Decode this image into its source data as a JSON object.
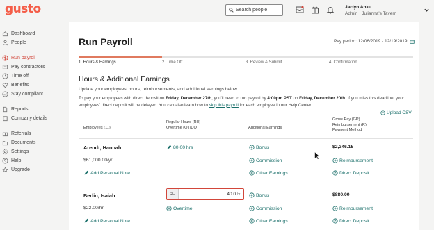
{
  "topbar": {
    "logo": "gusto",
    "search_placeholder": "Search people",
    "user_name": "Jaclyn Anku",
    "user_role": "Admin · Julianna's Tavern",
    "icons": [
      "inbox-icon",
      "gift-icon",
      "bell-icon",
      "chevron-down-icon"
    ]
  },
  "sidebar": {
    "groups": [
      [
        {
          "label": "Dashboard",
          "icon": "home-icon"
        },
        {
          "label": "People",
          "icon": "person-icon"
        }
      ],
      [
        {
          "label": "Run payroll",
          "icon": "dollar-icon",
          "active": true
        },
        {
          "label": "Pay contractors",
          "icon": "contractor-icon"
        },
        {
          "label": "Time off",
          "icon": "clock-icon"
        },
        {
          "label": "Benefits",
          "icon": "heart-icon"
        },
        {
          "label": "Stay compliant",
          "icon": "check-icon"
        }
      ],
      [
        {
          "label": "Reports",
          "icon": "document-icon"
        },
        {
          "label": "Company details",
          "icon": "building-icon"
        }
      ],
      [
        {
          "label": "Referrals",
          "icon": "gift-icon"
        },
        {
          "label": "Documents",
          "icon": "folder-icon"
        },
        {
          "label": "Settings",
          "icon": "gear-icon"
        },
        {
          "label": "Help",
          "icon": "help-icon"
        },
        {
          "label": "Upgrade",
          "icon": "star-icon"
        }
      ]
    ]
  },
  "main": {
    "title": "Run Payroll",
    "pay_period": "Pay period: 12/06/2019 - 12/19/2019",
    "steps": [
      "1. Hours & Earnings",
      "2. Time Off",
      "3. Review & Submit",
      "4. Confirmation"
    ],
    "section_title": "Hours & Additional Earnings",
    "intro": "Update your employees' hours, reimbursements, and additional earnings below.",
    "notice": {
      "t1": "To pay your employees with direct deposit on ",
      "d1": "Friday, December 27th",
      "t2": ", you'll need to run payroll by ",
      "d2": "4:00pm PST",
      "t3": " on ",
      "d3": "Friday, December 20th",
      "t4": ". If you miss this deadline, your employees' direct deposit will be delayed. You can also learn how to ",
      "link": "skip this payroll",
      "t5": " for each employee in our Help Center."
    },
    "upload_csv": "Upload CSV",
    "table": {
      "col_employees": "Employees (11)",
      "col_hours_1": "Regular Hours (RH)",
      "col_hours_2": "Overtime (OT/DOT)",
      "col_additional": "Additional Earnings",
      "col_pay_1": "Gross Pay (GP)",
      "col_pay_2": "Reimbursement (R)",
      "col_pay_3": "Payment Method"
    },
    "employees": [
      {
        "name": "Arendt, Hannah",
        "rate": "$61,000.00/yr",
        "hours": "80.00 hrs",
        "note": "Add Personal Note",
        "earnings": [
          "Bonus",
          "Commission",
          "Other Earnings"
        ],
        "gross": "$2,346.15",
        "reimbursement": "Reimbursement",
        "method": "Direct Deposit"
      },
      {
        "name": "Berlin, Isaiah",
        "rate": "$22.00/hr",
        "rh_prefix": "RH",
        "rh_value": "40.0",
        "rh_suffix": "hr",
        "overtime": "Overtime",
        "note": "Add Personal Note",
        "earnings": [
          "Bonus",
          "Commission",
          "Other Earnings"
        ],
        "gross": "$880.00",
        "reimbursement": "Reimbursement",
        "method": "Direct Deposit"
      }
    ]
  }
}
